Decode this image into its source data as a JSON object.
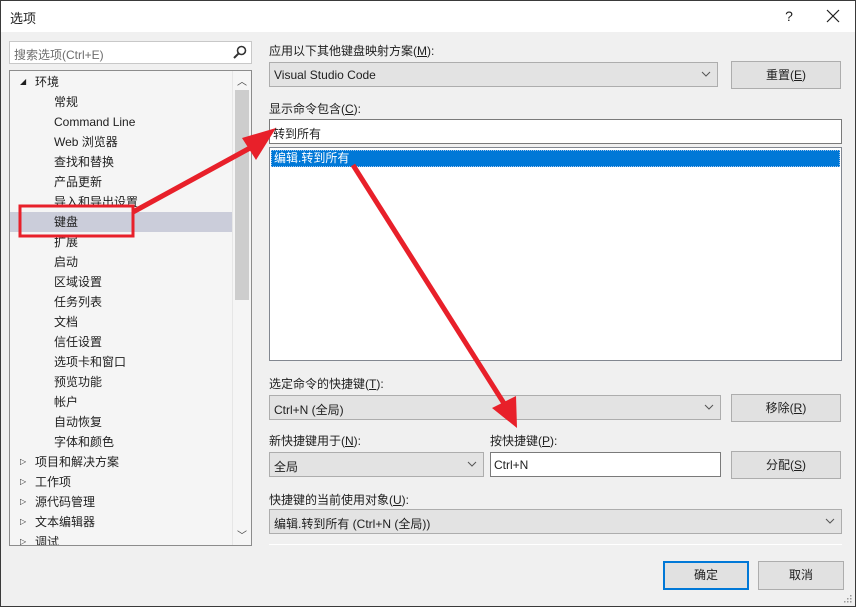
{
  "window": {
    "title": "选项",
    "help_label": "?",
    "close_label": "✕"
  },
  "search": {
    "placeholder": "搜索选项(Ctrl+E)"
  },
  "tree": {
    "items": [
      {
        "label": "环境",
        "level": 0,
        "expander": "expanded"
      },
      {
        "label": "常规",
        "level": 1
      },
      {
        "label": "Command Line",
        "level": 1
      },
      {
        "label": "Web 浏览器",
        "level": 1
      },
      {
        "label": "查找和替换",
        "level": 1
      },
      {
        "label": "产品更新",
        "level": 1
      },
      {
        "label": "导入和导出设置",
        "level": 1
      },
      {
        "label": "键盘",
        "level": 1,
        "selected": true
      },
      {
        "label": "扩展",
        "level": 1
      },
      {
        "label": "启动",
        "level": 1
      },
      {
        "label": "区域设置",
        "level": 1
      },
      {
        "label": "任务列表",
        "level": 1
      },
      {
        "label": "文档",
        "level": 1
      },
      {
        "label": "信任设置",
        "level": 1
      },
      {
        "label": "选项卡和窗口",
        "level": 1
      },
      {
        "label": "预览功能",
        "level": 1
      },
      {
        "label": "帐户",
        "level": 1
      },
      {
        "label": "自动恢复",
        "level": 1
      },
      {
        "label": "字体和颜色",
        "level": 1
      },
      {
        "label": "项目和解决方案",
        "level": 0,
        "expander": "collapsed"
      },
      {
        "label": "工作项",
        "level": 0,
        "expander": "collapsed"
      },
      {
        "label": "源代码管理",
        "level": 0,
        "expander": "collapsed"
      },
      {
        "label": "文本编辑器",
        "level": 0,
        "expander": "collapsed"
      },
      {
        "label": "调试",
        "level": 0,
        "expander": "collapsed"
      }
    ]
  },
  "keyboard": {
    "mapping_label": "应用以下其他键盘映射方案(",
    "mapping_key": "M",
    "mapping_suffix": "):",
    "mapping_value": "Visual Studio Code",
    "reset_label": "重置(",
    "reset_key": "E",
    "reset_suffix": ")",
    "filter_label": "显示命令包含(",
    "filter_key": "C",
    "filter_suffix": "):",
    "filter_value": "转到所有",
    "commands": [
      "编辑.转到所有"
    ],
    "shortcuts_label": "选定命令的快捷键(",
    "shortcuts_key": "T",
    "shortcuts_suffix": "):",
    "shortcuts_value": "Ctrl+N (全局)",
    "remove_label": "移除(",
    "remove_key": "R",
    "remove_suffix": ")",
    "use_in_label": "新快捷键用于(",
    "use_in_key": "N",
    "use_in_suffix": "):",
    "use_in_value": "全局",
    "press_label": "按快捷键(",
    "press_key": "P",
    "press_suffix": "):",
    "press_value": "Ctrl+N",
    "assign_label": "分配(",
    "assign_key": "S",
    "assign_suffix": ")",
    "used_by_label": "快捷键的当前使用对象(",
    "used_by_key": "U",
    "used_by_suffix": "):",
    "used_by_value": "编辑.转到所有 (Ctrl+N (全局))"
  },
  "footer": {
    "ok_label": "确定",
    "cancel_label": "取消"
  },
  "colors": {
    "accent": "#0078d7",
    "selection_bg": "#cbcdda",
    "annotation_red": "#e8202a"
  }
}
